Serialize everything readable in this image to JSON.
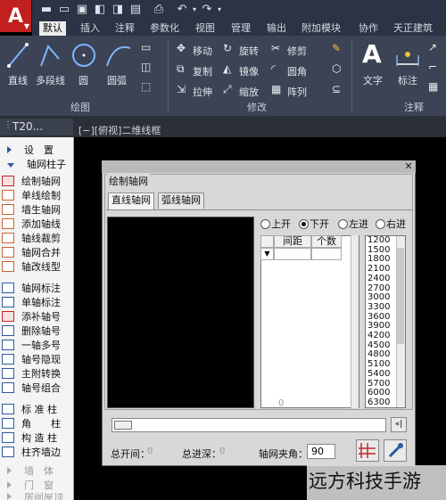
{
  "app": {
    "logo_letter": "A"
  },
  "ribbon_tabs": [
    "默认",
    "插入",
    "注释",
    "参数化",
    "视图",
    "管理",
    "输出",
    "附加模块",
    "协作",
    "天正建筑"
  ],
  "draw_group": {
    "label": "绘图",
    "tools": [
      "直线",
      "多段线",
      "圆",
      "圆弧"
    ]
  },
  "modify_group": {
    "label": "修改",
    "tools": [
      "移动",
      "旋转",
      "修剪",
      "复制",
      "镜像",
      "圆角",
      "拉伸",
      "缩放",
      "阵列"
    ]
  },
  "annotate_group": {
    "label": "注释",
    "tools": [
      "文字",
      "标注"
    ]
  },
  "document_tab": "T20...",
  "viewport_label": "[−][俯视]二维线框",
  "left_panel": {
    "headers": [
      "设　置",
      "轴网柱子"
    ],
    "items": [
      "绘制轴网",
      "单线绘制",
      "墙生轴网",
      "添加轴线",
      "轴线裁剪",
      "轴网合并",
      "轴改线型",
      "轴网标注",
      "单轴标注",
      "添补轴号",
      "删除轴号",
      "一轴多号",
      "轴号隐现",
      "主附转换",
      "轴号组合",
      "标 准 柱",
      "角　　柱",
      "构 造 柱",
      "柱齐墙边"
    ],
    "dim_items": [
      "墙　体",
      "门　窗",
      "房间屋顶"
    ]
  },
  "dialog": {
    "title": "绘制轴网",
    "tabs": [
      "直线轴网",
      "弧线轴网"
    ],
    "radios": [
      {
        "label": "上开",
        "checked": false
      },
      {
        "label": "下开",
        "checked": true
      },
      {
        "label": "左进",
        "checked": false
      },
      {
        "label": "右进",
        "checked": false
      }
    ],
    "grid_headers": [
      "间距",
      "个数"
    ],
    "grid_footer": "0",
    "values": [
      "1200",
      "1500",
      "1800",
      "2100",
      "2400",
      "2700",
      "3000",
      "3300",
      "3600",
      "3900",
      "4200",
      "4500",
      "4800",
      "5100",
      "5400",
      "5700",
      "6000",
      "6300"
    ],
    "cmd_button": "«|",
    "footer": {
      "total_open_label": "总开间：",
      "total_open_value": "0",
      "total_depth_label": "总进深：",
      "total_depth_value": "0",
      "angle_label": "轴网夹角：",
      "angle_value": "90"
    }
  },
  "watermark": "远方科技手游"
}
